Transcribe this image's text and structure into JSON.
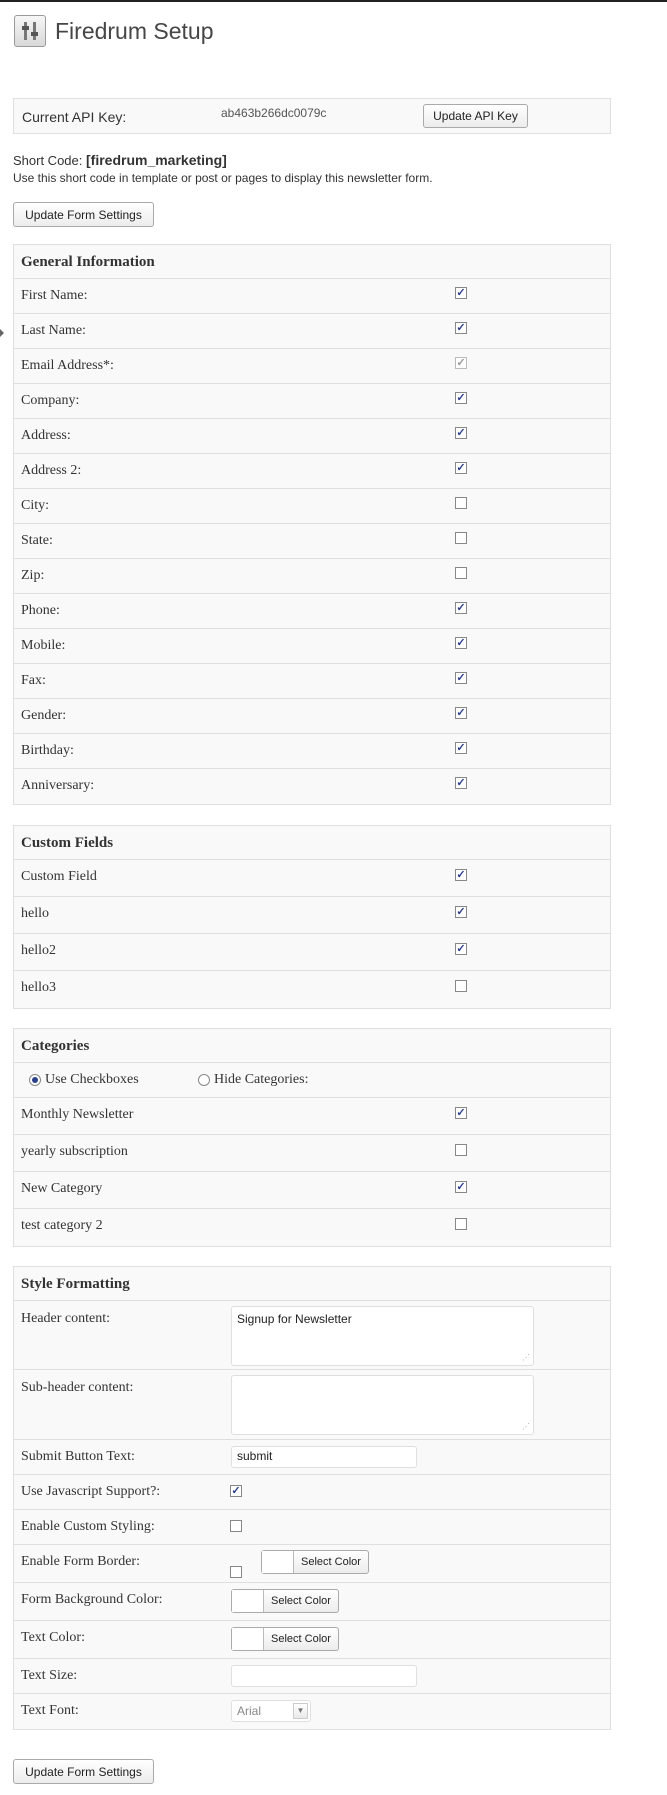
{
  "app": {
    "title": "Firedrum Setup",
    "icon": "settings-sliders-icon"
  },
  "api": {
    "label": "Current API Key:",
    "value": "ab463b266dc0079c",
    "update_button": "Update API Key"
  },
  "shortcode": {
    "prefix": "Short Code:",
    "code": "[firedrum_marketing]",
    "description": "Use this short code in template or post or pages to display this newsletter form."
  },
  "update_form_button": "Update Form Settings",
  "general": {
    "title": "General Information",
    "fields": [
      {
        "label": "First Name:",
        "checked": true
      },
      {
        "label": "Last Name:",
        "checked": true
      },
      {
        "label": "Email Address*:",
        "checked": true,
        "disabled": true
      },
      {
        "label": "Company:",
        "checked": true
      },
      {
        "label": "Address:",
        "checked": true
      },
      {
        "label": "Address 2:",
        "checked": true
      },
      {
        "label": "City:",
        "checked": false
      },
      {
        "label": "State:",
        "checked": false
      },
      {
        "label": "Zip:",
        "checked": false
      },
      {
        "label": "Phone:",
        "checked": true
      },
      {
        "label": "Mobile:",
        "checked": true
      },
      {
        "label": "Fax:",
        "checked": true
      },
      {
        "label": "Gender:",
        "checked": true
      },
      {
        "label": "Birthday:",
        "checked": true
      },
      {
        "label": "Anniversary:",
        "checked": true
      }
    ]
  },
  "custom": {
    "title": "Custom Fields",
    "fields": [
      {
        "label": "Custom Field",
        "checked": true
      },
      {
        "label": "hello",
        "checked": true
      },
      {
        "label": "hello2",
        "checked": true
      },
      {
        "label": "hello3",
        "checked": false
      }
    ]
  },
  "categories": {
    "title": "Categories",
    "option_checkboxes": "Use Checkboxes",
    "option_hide": "Hide Categories:",
    "selected_option": "Use Checkboxes",
    "items": [
      {
        "label": "Monthly Newsletter",
        "checked": true
      },
      {
        "label": "yearly subscription",
        "checked": false
      },
      {
        "label": "New Category",
        "checked": true
      },
      {
        "label": "test category 2",
        "checked": false
      }
    ]
  },
  "style": {
    "title": "Style Formatting",
    "header_label": "Header content:",
    "header_value": "Signup for Newsletter",
    "subheader_label": "Sub-header content:",
    "subheader_value": "",
    "submit_label": "Submit Button Text:",
    "submit_value": "submit",
    "js_label": "Use Javascript Support?:",
    "js_checked": true,
    "custom_label": "Enable Custom Styling:",
    "custom_checked": false,
    "border_label": "Enable Form Border:",
    "border_checked": false,
    "bg_label": "Form Background Color:",
    "text_color_label": "Text Color:",
    "select_color": "Select Color",
    "text_size_label": "Text Size:",
    "text_size_value": "",
    "text_font_label": "Text Font:",
    "text_font_value": "Arial"
  }
}
